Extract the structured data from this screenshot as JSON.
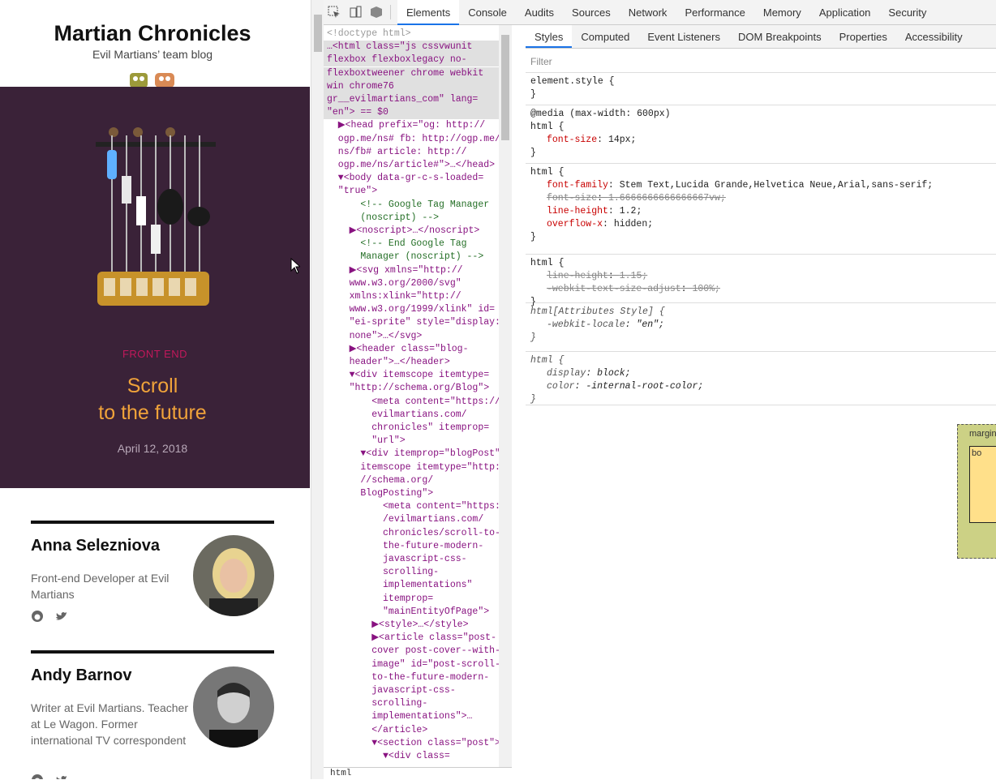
{
  "blog": {
    "title": "Martian Chronicles",
    "subtitle": "Evil Martians’ team blog",
    "cover": {
      "rubric": "FRONT END",
      "title_line1": "Scroll",
      "title_line2": "to the future",
      "date": "April 12, 2018"
    },
    "authors": [
      {
        "name": "Anna Selezniova",
        "role": "Front-end Developer at Evil Martians",
        "social": [
          "github-icon",
          "twitter-icon"
        ]
      },
      {
        "name": "Andy Barnov",
        "role": "Writer at Evil Martians. Teacher at Le Wagon. Former international TV correspondent",
        "social": [
          "github-icon",
          "twitter-icon"
        ]
      }
    ]
  },
  "devtools": {
    "tabs": [
      "Elements",
      "Console",
      "Audits",
      "Sources",
      "Network",
      "Performance",
      "Memory",
      "Application",
      "Security"
    ],
    "active_tab": "Elements",
    "styles_tabs": [
      "Styles",
      "Computed",
      "Event Listeners",
      "DOM Breakpoints",
      "Properties",
      "Accessibility"
    ],
    "active_styles_tab": "Styles",
    "filter_placeholder": "Filter",
    "breadcrumb": "html",
    "dom_lines": [
      "<!doctype html>",
      "…<html class=\"js cssvwunit",
      "flexbox flexboxlegacy no-",
      "flexboxtweener chrome webkit",
      "win chrome76",
      "gr__evilmartians_com\" lang=",
      "\"en\"> == $0",
      "  ▶<head prefix=\"og: http://",
      "  ogp.me/ns# fb: http://ogp.me/",
      "  ns/fb# article: http://",
      "  ogp.me/ns/article#\">…</head>",
      "  ▼<body data-gr-c-s-loaded=",
      "  \"true\">",
      "      <!-- Google Tag Manager",
      "      (noscript) -->",
      "    ▶<noscript>…</noscript>",
      "      <!-- End Google Tag",
      "      Manager (noscript) -->",
      "    ▶<svg xmlns=\"http://",
      "    www.w3.org/2000/svg\"",
      "    xmlns:xlink=\"http://",
      "    www.w3.org/1999/xlink\" id=",
      "    \"ei-sprite\" style=\"display:",
      "    none\">…</svg>",
      "    ▶<header class=\"blog-",
      "    header\">…</header>",
      "    ▼<div itemscope itemtype=",
      "    \"http://schema.org/Blog\">",
      "        <meta content=\"https://",
      "        evilmartians.com/",
      "        chronicles\" itemprop=",
      "        \"url\">",
      "      ▼<div itemprop=\"blogPost\"",
      "      itemscope itemtype=\"http:",
      "      //schema.org/",
      "      BlogPosting\">",
      "          <meta content=\"https:/",
      "          /evilmartians.com/",
      "          chronicles/scroll-to-",
      "          the-future-modern-",
      "          javascript-css-",
      "          scrolling-",
      "          implementations\"",
      "          itemprop=",
      "          \"mainEntityOfPage\">",
      "        ▶<style>…</style>",
      "        ▶<article class=\"post-",
      "        cover post-cover--with-",
      "        image\" id=\"post-scroll-",
      "        to-the-future-modern-",
      "        javascript-css-",
      "        scrolling-",
      "        implementations\">…",
      "        </article>",
      "        ▼<section class=\"post\">",
      "          ▼<div class="
    ],
    "css_rules": [
      {
        "selector": "element.style {",
        "props": [],
        "close": "}"
      },
      {
        "selector": "@media (max-width: 600px)",
        "selector2": "html {",
        "props": [
          {
            "name": "font-size",
            "value": "14px;",
            "struck": false
          }
        ],
        "close": "}"
      },
      {
        "selector": "html {",
        "props": [
          {
            "name": "font-family",
            "value": "Stem Text,Lucida Grande,Helvetica Neue,Arial,sans-serif;",
            "struck": false
          },
          {
            "name": "font-size",
            "value": "1.6666666666666667vw;",
            "struck": true
          },
          {
            "name": "line-height",
            "value": "1.2;",
            "struck": false
          },
          {
            "name": "overflow-x",
            "value": "hidden;",
            "struck": false
          }
        ],
        "close": "}"
      },
      {
        "selector": "html {",
        "props": [
          {
            "name": "line-height",
            "value": "1.15;",
            "struck": true
          },
          {
            "name": "-webkit-text-size-adjust",
            "value": "100%;",
            "struck": true
          }
        ],
        "close": "}"
      },
      {
        "selector": "html[Attributes Style] {",
        "ua": true,
        "props": [
          {
            "name": "-webkit-locale",
            "value": "\"en\";",
            "struck": false
          }
        ],
        "close": "}"
      },
      {
        "selector": "html {",
        "ua": true,
        "props": [
          {
            "name": "display",
            "value": "block;",
            "struck": false
          },
          {
            "name": "color",
            "value": "-internal-root-color;",
            "struck": false
          }
        ],
        "close": "}"
      }
    ],
    "box_model": {
      "label1": "margin",
      "label2": "bo"
    }
  }
}
